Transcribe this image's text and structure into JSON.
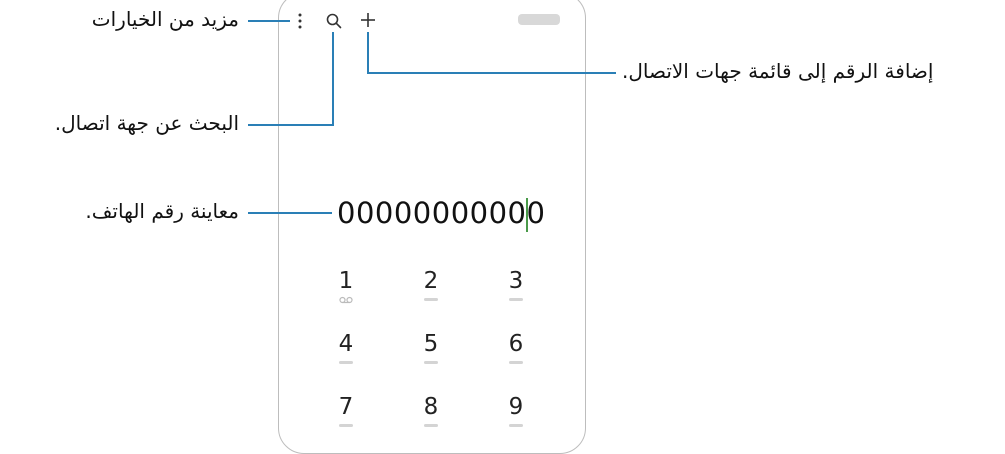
{
  "dialer": {
    "number": "00000000000",
    "keys": [
      {
        "digit": "1",
        "sub_icon": "voicemail-icon"
      },
      {
        "digit": "2"
      },
      {
        "digit": "3"
      },
      {
        "digit": "4"
      },
      {
        "digit": "5"
      },
      {
        "digit": "6"
      },
      {
        "digit": "7"
      },
      {
        "digit": "8"
      },
      {
        "digit": "9"
      }
    ]
  },
  "toolbar": {
    "icons": [
      "more-options-icon",
      "search-icon",
      "add-icon"
    ]
  },
  "callouts": {
    "more_options": "مزيد من الخيارات",
    "search_contact": "البحث عن جهة اتصال.",
    "preview_number": "معاينة رقم الهاتف.",
    "add_to_contacts": "إضافة الرقم إلى قائمة جهات الاتصال."
  },
  "colors": {
    "callout_line": "#2a7fb6",
    "cursor": "#4a9a4a"
  }
}
